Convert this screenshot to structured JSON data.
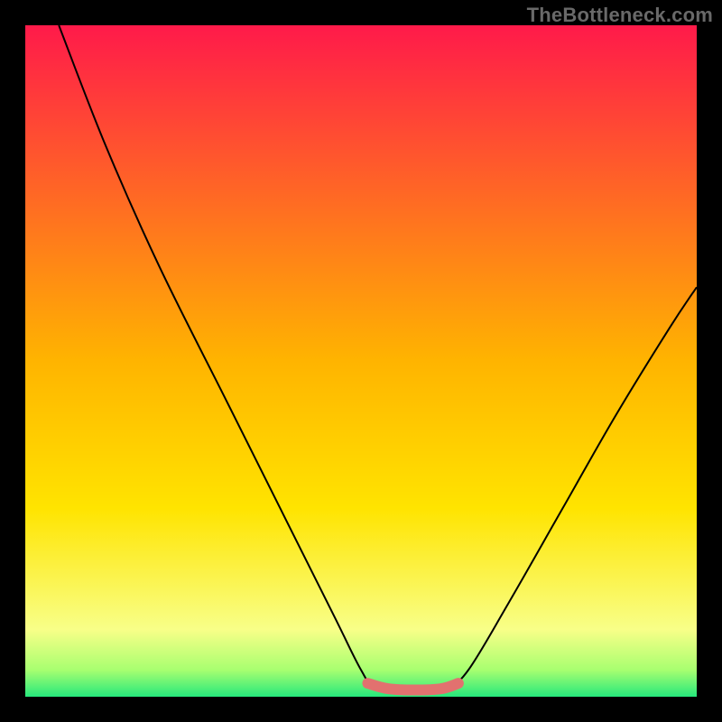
{
  "watermark": "TheBottleneck.com",
  "chart_data": {
    "type": "line",
    "title": "",
    "xlabel": "",
    "ylabel": "",
    "xlim": [
      0,
      100
    ],
    "ylim": [
      0,
      100
    ],
    "grid": false,
    "legend": false,
    "background_gradient": {
      "stops": [
        {
          "pos": 0.0,
          "color": "#ff1a4a"
        },
        {
          "pos": 0.5,
          "color": "#ffb400"
        },
        {
          "pos": 0.72,
          "color": "#ffe400"
        },
        {
          "pos": 0.9,
          "color": "#f8ff88"
        },
        {
          "pos": 0.96,
          "color": "#a8ff70"
        },
        {
          "pos": 1.0,
          "color": "#26e87c"
        }
      ]
    },
    "series": [
      {
        "name": "curve",
        "stroke": "#000000",
        "stroke_width": 2,
        "points": [
          {
            "x": 5.0,
            "y": 100.0
          },
          {
            "x": 12.0,
            "y": 82.0
          },
          {
            "x": 20.0,
            "y": 64.0
          },
          {
            "x": 30.0,
            "y": 44.0
          },
          {
            "x": 38.0,
            "y": 28.0
          },
          {
            "x": 46.0,
            "y": 12.0
          },
          {
            "x": 50.0,
            "y": 4.0
          },
          {
            "x": 52.0,
            "y": 1.5
          },
          {
            "x": 56.0,
            "y": 1.0
          },
          {
            "x": 60.0,
            "y": 1.0
          },
          {
            "x": 63.0,
            "y": 1.5
          },
          {
            "x": 66.0,
            "y": 4.0
          },
          {
            "x": 72.0,
            "y": 14.0
          },
          {
            "x": 80.0,
            "y": 28.0
          },
          {
            "x": 88.0,
            "y": 42.0
          },
          {
            "x": 96.0,
            "y": 55.0
          },
          {
            "x": 100.0,
            "y": 61.0
          }
        ]
      },
      {
        "name": "highlight-flat",
        "stroke": "#e2716f",
        "stroke_width": 12,
        "linecap": "round",
        "points": [
          {
            "x": 51.0,
            "y": 2.0
          },
          {
            "x": 54.0,
            "y": 1.2
          },
          {
            "x": 58.0,
            "y": 1.0
          },
          {
            "x": 62.0,
            "y": 1.2
          },
          {
            "x": 64.5,
            "y": 2.0
          }
        ]
      }
    ]
  }
}
